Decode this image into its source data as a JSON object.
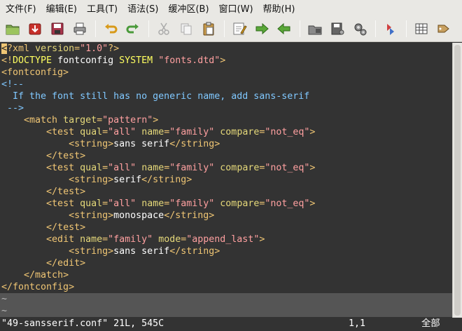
{
  "menubar": {
    "items": [
      "文件(F)",
      "编辑(E)",
      "工具(T)",
      "语法(S)",
      "缓冲区(B)",
      "窗口(W)",
      "帮助(H)"
    ]
  },
  "toolbar": {
    "buttons": [
      "open-folder",
      "save-download",
      "save",
      "print",
      "undo",
      "redo",
      "cut",
      "copy",
      "paste",
      "find-replace",
      "forward",
      "back",
      "load-session",
      "save-session",
      "run-script",
      "make",
      "shell",
      "tags"
    ]
  },
  "syntax_colors": {
    "tag": "#f0c674",
    "attr": "#e6d97a",
    "string": "#ffa0a0",
    "comment": "#80c8ff",
    "text": "#ffffff",
    "keyword": "#ffff60",
    "decl": "#ff80ff"
  },
  "editor": {
    "lines": [
      [
        {
          "t": "<",
          "c": "cursor"
        },
        {
          "t": "?xml",
          "c": "tag"
        },
        {
          "t": " ",
          "c": "text"
        },
        {
          "t": "version",
          "c": "attr"
        },
        {
          "t": "=",
          "c": "tag"
        },
        {
          "t": "\"1.0\"",
          "c": "string"
        },
        {
          "t": "?>",
          "c": "tag"
        }
      ],
      [
        {
          "t": "<!",
          "c": "tag"
        },
        {
          "t": "DOCTYPE",
          "c": "keyword"
        },
        {
          "t": " fontconfig ",
          "c": "text"
        },
        {
          "t": "SYSTEM",
          "c": "keyword"
        },
        {
          "t": " ",
          "c": "text"
        },
        {
          "t": "\"fonts.dtd\"",
          "c": "string"
        },
        {
          "t": ">",
          "c": "tag"
        }
      ],
      [
        {
          "t": "<fontconfig>",
          "c": "tag"
        }
      ],
      [
        {
          "t": "<!--",
          "c": "comment"
        }
      ],
      [
        {
          "t": "  If the font still has no generic name, add sans-serif",
          "c": "comment"
        }
      ],
      [
        {
          "t": " -->",
          "c": "comment"
        }
      ],
      [
        {
          "t": "    ",
          "c": "text"
        },
        {
          "t": "<match",
          "c": "tag"
        },
        {
          "t": " ",
          "c": "text"
        },
        {
          "t": "target",
          "c": "attr"
        },
        {
          "t": "=",
          "c": "tag"
        },
        {
          "t": "\"pattern\"",
          "c": "string"
        },
        {
          "t": ">",
          "c": "tag"
        }
      ],
      [
        {
          "t": "        ",
          "c": "text"
        },
        {
          "t": "<test",
          "c": "tag"
        },
        {
          "t": " ",
          "c": "text"
        },
        {
          "t": "qual",
          "c": "attr"
        },
        {
          "t": "=",
          "c": "tag"
        },
        {
          "t": "\"all\"",
          "c": "string"
        },
        {
          "t": " ",
          "c": "text"
        },
        {
          "t": "name",
          "c": "attr"
        },
        {
          "t": "=",
          "c": "tag"
        },
        {
          "t": "\"family\"",
          "c": "string"
        },
        {
          "t": " ",
          "c": "text"
        },
        {
          "t": "compare",
          "c": "attr"
        },
        {
          "t": "=",
          "c": "tag"
        },
        {
          "t": "\"not_eq\"",
          "c": "string"
        },
        {
          "t": ">",
          "c": "tag"
        }
      ],
      [
        {
          "t": "            ",
          "c": "text"
        },
        {
          "t": "<string>",
          "c": "tag"
        },
        {
          "t": "sans serif",
          "c": "text"
        },
        {
          "t": "</string>",
          "c": "tag"
        }
      ],
      [
        {
          "t": "        ",
          "c": "text"
        },
        {
          "t": "</test>",
          "c": "tag"
        }
      ],
      [
        {
          "t": "        ",
          "c": "text"
        },
        {
          "t": "<test",
          "c": "tag"
        },
        {
          "t": " ",
          "c": "text"
        },
        {
          "t": "qual",
          "c": "attr"
        },
        {
          "t": "=",
          "c": "tag"
        },
        {
          "t": "\"all\"",
          "c": "string"
        },
        {
          "t": " ",
          "c": "text"
        },
        {
          "t": "name",
          "c": "attr"
        },
        {
          "t": "=",
          "c": "tag"
        },
        {
          "t": "\"family\"",
          "c": "string"
        },
        {
          "t": " ",
          "c": "text"
        },
        {
          "t": "compare",
          "c": "attr"
        },
        {
          "t": "=",
          "c": "tag"
        },
        {
          "t": "\"not_eq\"",
          "c": "string"
        },
        {
          "t": ">",
          "c": "tag"
        }
      ],
      [
        {
          "t": "            ",
          "c": "text"
        },
        {
          "t": "<string>",
          "c": "tag"
        },
        {
          "t": "serif",
          "c": "text"
        },
        {
          "t": "</string>",
          "c": "tag"
        }
      ],
      [
        {
          "t": "        ",
          "c": "text"
        },
        {
          "t": "</test>",
          "c": "tag"
        }
      ],
      [
        {
          "t": "        ",
          "c": "text"
        },
        {
          "t": "<test",
          "c": "tag"
        },
        {
          "t": " ",
          "c": "text"
        },
        {
          "t": "qual",
          "c": "attr"
        },
        {
          "t": "=",
          "c": "tag"
        },
        {
          "t": "\"all\"",
          "c": "string"
        },
        {
          "t": " ",
          "c": "text"
        },
        {
          "t": "name",
          "c": "attr"
        },
        {
          "t": "=",
          "c": "tag"
        },
        {
          "t": "\"family\"",
          "c": "string"
        },
        {
          "t": " ",
          "c": "text"
        },
        {
          "t": "compare",
          "c": "attr"
        },
        {
          "t": "=",
          "c": "tag"
        },
        {
          "t": "\"not_eq\"",
          "c": "string"
        },
        {
          "t": ">",
          "c": "tag"
        }
      ],
      [
        {
          "t": "            ",
          "c": "text"
        },
        {
          "t": "<string>",
          "c": "tag"
        },
        {
          "t": "monospace",
          "c": "text"
        },
        {
          "t": "</string>",
          "c": "tag"
        }
      ],
      [
        {
          "t": "        ",
          "c": "text"
        },
        {
          "t": "</test>",
          "c": "tag"
        }
      ],
      [
        {
          "t": "        ",
          "c": "text"
        },
        {
          "t": "<edit",
          "c": "tag"
        },
        {
          "t": " ",
          "c": "text"
        },
        {
          "t": "name",
          "c": "attr"
        },
        {
          "t": "=",
          "c": "tag"
        },
        {
          "t": "\"family\"",
          "c": "string"
        },
        {
          "t": " ",
          "c": "text"
        },
        {
          "t": "mode",
          "c": "attr"
        },
        {
          "t": "=",
          "c": "tag"
        },
        {
          "t": "\"append_last\"",
          "c": "string"
        },
        {
          "t": ">",
          "c": "tag"
        }
      ],
      [
        {
          "t": "            ",
          "c": "text"
        },
        {
          "t": "<string>",
          "c": "tag"
        },
        {
          "t": "sans serif",
          "c": "text"
        },
        {
          "t": "</string>",
          "c": "tag"
        }
      ],
      [
        {
          "t": "        ",
          "c": "text"
        },
        {
          "t": "</edit>",
          "c": "tag"
        }
      ],
      [
        {
          "t": "    ",
          "c": "text"
        },
        {
          "t": "</match>",
          "c": "tag"
        }
      ],
      [
        {
          "t": "</fontconfig>",
          "c": "tag"
        }
      ]
    ],
    "filler_lines": [
      "~",
      "~"
    ]
  },
  "statusline": {
    "file": "\"49-sansserif.conf\" 21L, 545C",
    "position": "1,1",
    "scroll": "全部"
  }
}
